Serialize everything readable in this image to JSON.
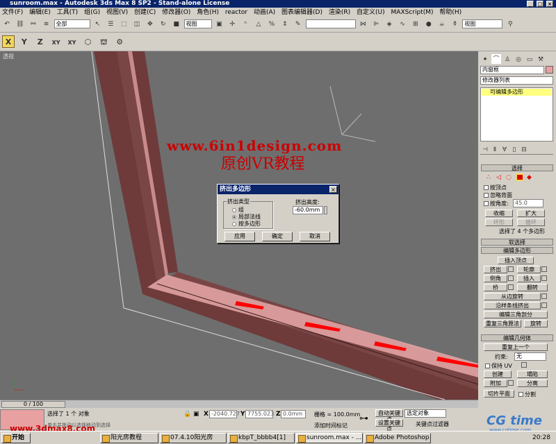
{
  "window": {
    "title": "sunroom.max - Autodesk 3ds Max 8 SP2 - Stand-alone License",
    "min": "_",
    "max": "□",
    "close": "×"
  },
  "menu": [
    "文件(F)",
    "编辑(E)",
    "工具(T)",
    "组(G)",
    "视图(V)",
    "创建(C)",
    "修改器(O)",
    "角色(H)",
    "reactor",
    "动画(A)",
    "图表编辑器(D)",
    "渲染(R)",
    "自定义(U)",
    "MAXScript(M)",
    "帮助(H)"
  ],
  "toolbar": {
    "selection_filter": "全部",
    "ref_coord": "视图",
    "named_sel": "",
    "render_view": "视图"
  },
  "axis_buttons": [
    "X",
    "Y",
    "Z",
    "XY",
    "XY"
  ],
  "viewport": {
    "label": "透视",
    "watermark_url": "www.6in1design.com",
    "watermark_text": "原创VR教程"
  },
  "dialog": {
    "title": "挤出多边形",
    "close": "×",
    "group_label": "挤出类型",
    "options": [
      {
        "label": "组",
        "selected": false
      },
      {
        "label": "局部法线",
        "selected": true
      },
      {
        "label": "按多边形",
        "selected": false
      }
    ],
    "height_label": "挤出高度:",
    "height_value": "-60.0mm",
    "apply": "应用",
    "ok": "确定",
    "cancel": "取消"
  },
  "command_panel": {
    "object_name": "内窗框",
    "modifier_list": "修改器列表",
    "stack_item": "可编辑多边形",
    "selection": {
      "header": "选择",
      "by_vertex": "按顶点",
      "ignore_backfacing": "忽略背面",
      "by_angle": "按角度:",
      "angle_value": "45.0",
      "shrink": "收缩",
      "grow": "扩大",
      "ring": "环形",
      "loop": "循环",
      "status": "选择了 4 个多边形"
    },
    "soft_selection": "软选择",
    "edit_polygons": {
      "header": "编辑多边形",
      "insert_vertex": "插入顶点",
      "extrude": "挤出",
      "outline": "轮廓",
      "bevel": "倒角",
      "inset": "插入",
      "bridge": "桥",
      "flip": "翻转",
      "hinge": "从边旋转",
      "extrude_along_spline": "沿样条线挤出",
      "edit_triangulation": "编辑三角剖分",
      "retriangulate": "重复三角算法",
      "turn": "旋转"
    },
    "edit_geometry": {
      "header": "编辑几何体",
      "repeat_last": "重复上一个",
      "constraints": "约束:",
      "constraints_value": "无",
      "preserve_uvs": "保持 UV",
      "create": "创建",
      "collapse": "塌陷",
      "attach": "附加",
      "detach": "分离",
      "slice_plane": "切片平面",
      "split": "分割",
      "slice": "切片",
      "reset_plane": "重置平面"
    }
  },
  "timeline": {
    "frame": "0 / 100"
  },
  "status": {
    "selected": "选择了 1 个 对象",
    "prompt": "单击并拖动以选择移动到选择",
    "x_label": "X",
    "x_value": "-2040.727",
    "y_label": "Y",
    "y_value": "7755.023",
    "z_label": "Z",
    "z_value": "0.0mm",
    "grid": "栅格 = 100.0mm",
    "add_time_tag": "添加时间标记",
    "auto_key": "自动关键点",
    "set_key": "设置关键点",
    "selected_obj": "选定对象",
    "key_filters": "关键点过滤器"
  },
  "taskbar": {
    "start": "开始",
    "items": [
      "阳光房教程",
      "07.4.10阳光房",
      "kbpT_bbbb4[1]",
      "sunroom.max - ...",
      "Adobe Photoshop"
    ],
    "clock": "20:28"
  },
  "overlays": {
    "site_left": "www.3dmax8.com",
    "site_right": "CG time",
    "site_right_sub": "www.cgtime.com"
  },
  "colors": {
    "frame_dark": "#6e3a3a",
    "frame_light": "#e8a8a8",
    "selection_red": "#ff0000",
    "title_blue": "#0a246a",
    "panel_bg": "#d4d0c8",
    "viewport_bg": "#6e6e6e"
  }
}
